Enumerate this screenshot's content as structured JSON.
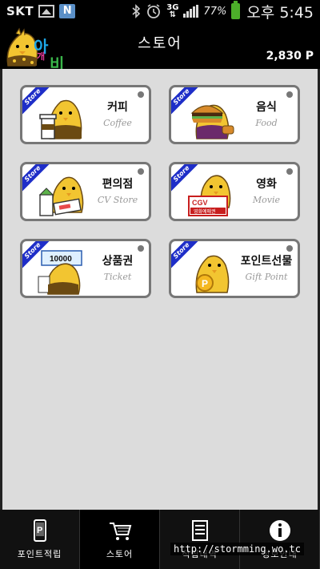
{
  "status_bar": {
    "carrier": "SKT",
    "network": "3G",
    "battery": "77%",
    "time": "오후 5:45"
  },
  "header": {
    "logo_text": {
      "a": "아",
      "gae": "개",
      "bi": "비"
    },
    "title": "스토어",
    "points": "2,830 P"
  },
  "cards": [
    {
      "ribbon": "Store",
      "label_ko": "커피",
      "label_en": "Coffee",
      "icon": "coffee-cup-icon"
    },
    {
      "ribbon": "Store",
      "label_ko": "음식",
      "label_en": "Food",
      "icon": "burger-icon"
    },
    {
      "ribbon": "Store",
      "label_ko": "편의점",
      "label_en": "CV Store",
      "icon": "convenience-store-icon"
    },
    {
      "ribbon": "Store",
      "label_ko": "영화",
      "label_en": "Movie",
      "icon": "cgv-icon",
      "icon_text": "CGV",
      "icon_subtext": "영화예매권"
    },
    {
      "ribbon": "Store",
      "label_ko": "상품권",
      "label_en": "Ticket",
      "icon": "gift-ticket-icon",
      "icon_text": "10000"
    },
    {
      "ribbon": "Store",
      "label_ko": "포인트선물",
      "label_en": "Gift Point",
      "icon": "gift-point-icon"
    }
  ],
  "bottom_nav": [
    {
      "label": "포인트적립",
      "icon": "phone-icon"
    },
    {
      "label": "스토어",
      "icon": "cart-icon",
      "active": true
    },
    {
      "label": "적립내역",
      "icon": "list-icon"
    },
    {
      "label": "정보안내",
      "icon": "info-icon"
    }
  ],
  "watermark": "http://stormming.wo.tc",
  "colors": {
    "ribbon_blue": "#1e2ec8",
    "content_bg": "#dcdcdc",
    "card_border": "#777777",
    "mascot_yellow": "#f2c531"
  }
}
